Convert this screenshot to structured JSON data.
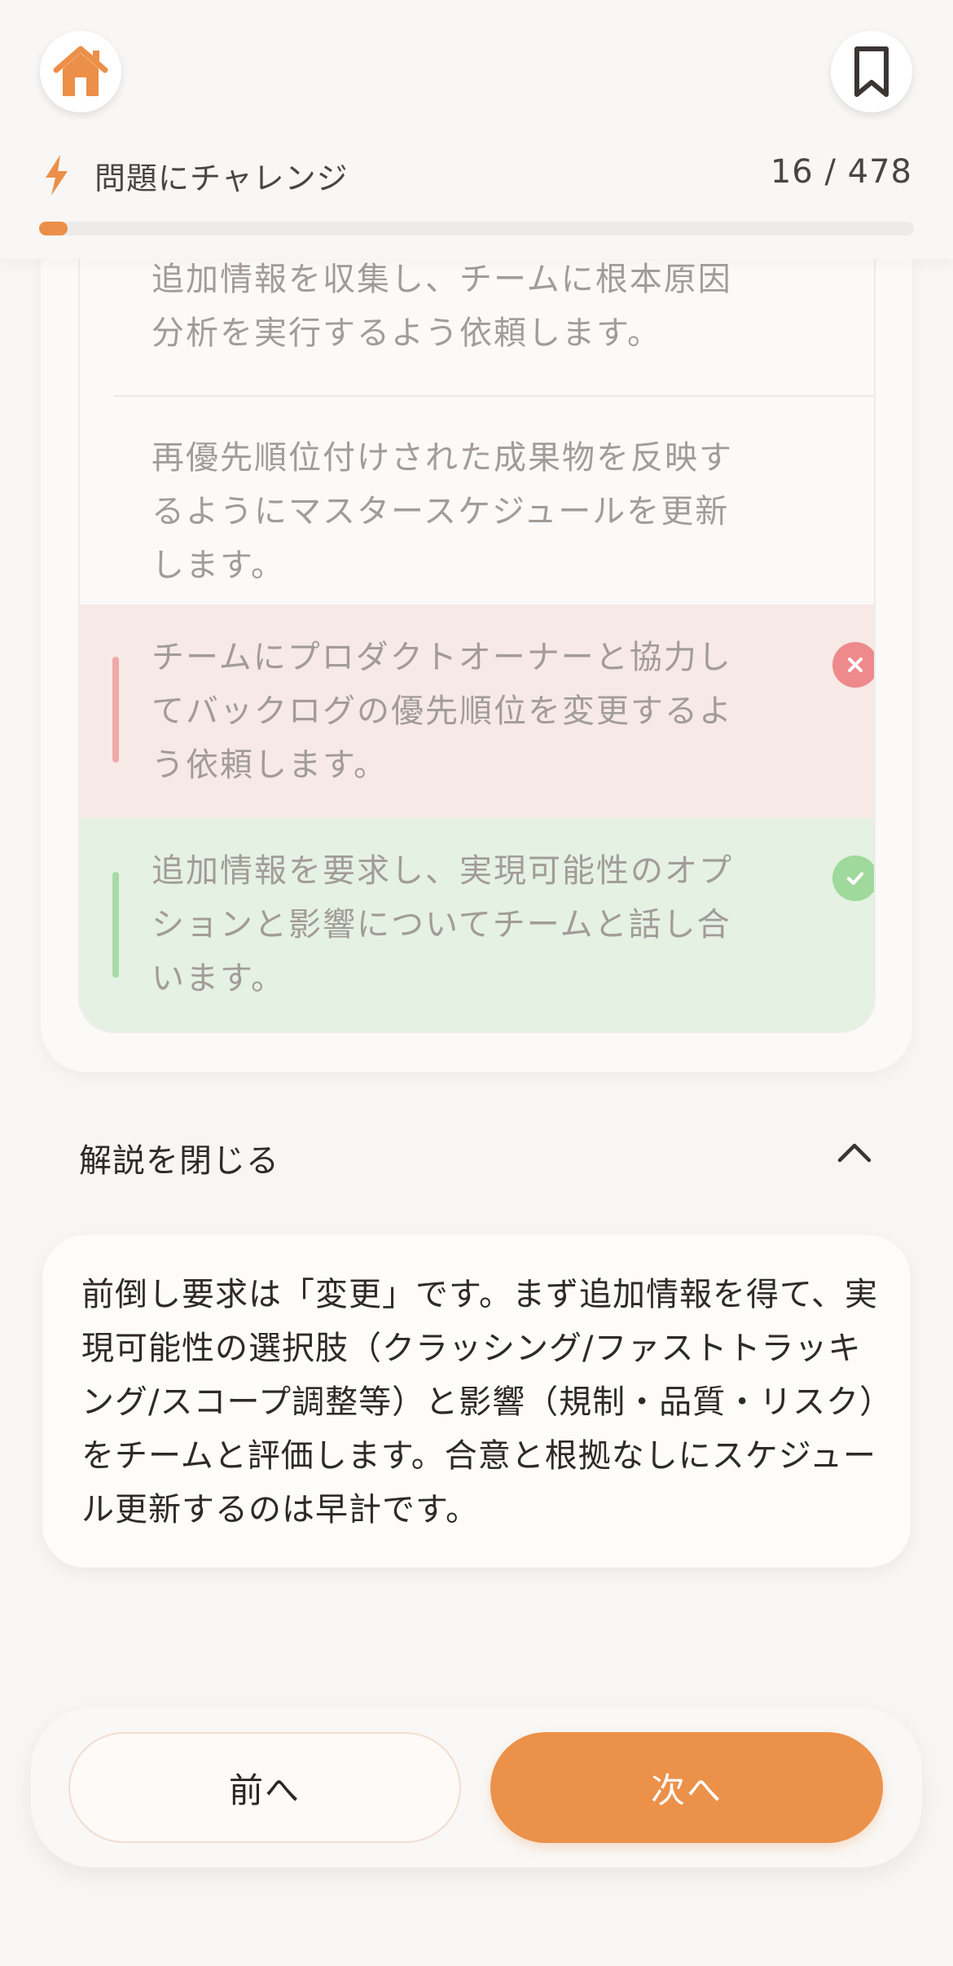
{
  "header": {
    "home_icon": "home-icon",
    "bookmark_icon": "bookmark-icon",
    "challenge_icon": "bolt-icon",
    "challenge_label": "問題にチャレンジ",
    "counter": "16 / 478",
    "progress": {
      "current": 16,
      "total": 478,
      "fraction": 0.033
    }
  },
  "options": [
    {
      "text": "追加情報を収集し、チームに根本原因分析を実行するよう依頼します。",
      "state": "neutral"
    },
    {
      "text": "再優先順位付けされた成果物を反映するようにマスタースケジュールを更新します。",
      "state": "neutral"
    },
    {
      "text": "チームにプロダクトオーナーと協力してバックログの優先順位を変更するよう依頼します。",
      "state": "wrong",
      "icon": "close-circle-icon"
    },
    {
      "text": "追加情報を要求し、実現可能性のオプションと影響についてチームと話し合います。",
      "state": "correct",
      "icon": "check-circle-icon"
    }
  ],
  "explanation": {
    "toggle_label": "解説を閉じる",
    "toggle_icon": "chevron-up-icon",
    "text": "前倒し要求は「変更」です。まず追加情報を得て、実現可能性の選択肢（クラッシング/ファストトラッキング/スコープ調整等）と影響（規制・品質・リスク）をチームと評価します。合意と根拠なしにスケジュール更新するのは早計です。"
  },
  "nav": {
    "prev_label": "前へ",
    "next_label": "次へ"
  },
  "colors": {
    "accent": "#ec914a",
    "wrong_bg": "#f6e9e6",
    "wrong_mark": "#ee8a8c",
    "correct_bg": "#e5f1e3",
    "correct_mark": "#9fd99b"
  }
}
